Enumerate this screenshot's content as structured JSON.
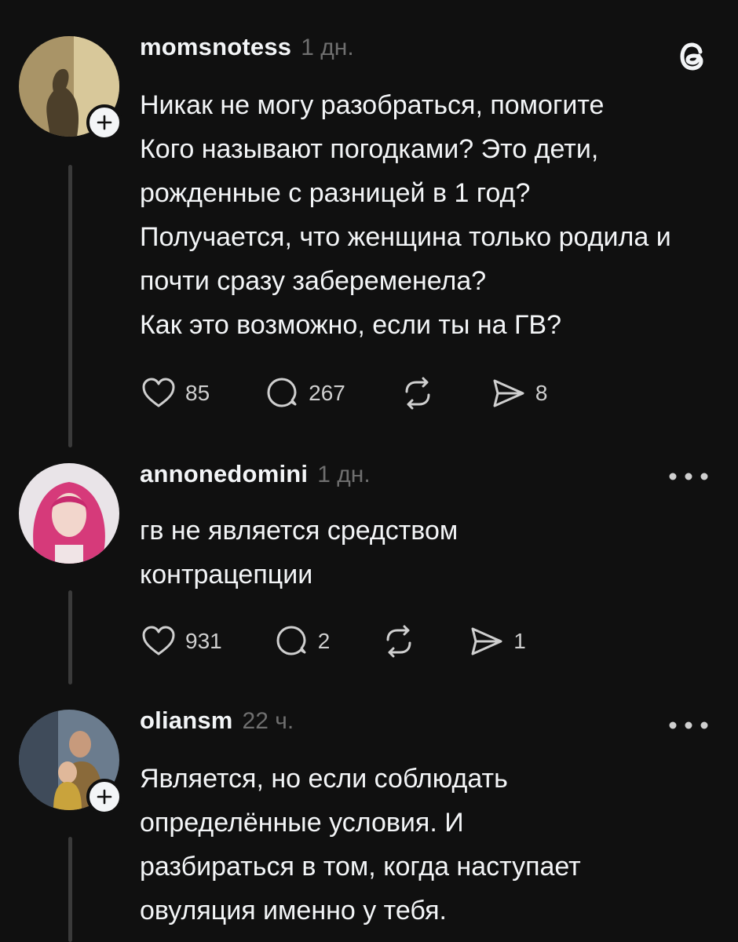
{
  "app": {
    "logo_icon": "threads-logo-icon"
  },
  "posts": [
    {
      "username": "momsnotess",
      "time": "1 дн.",
      "text": "Никак не могу разобраться, помогите\nКого называют погодками? Это дети, рожденные с разницей в 1 год?\nПолучается, что женщина только родила и почти сразу забеременела?\nКак это возможно, если ты на ГВ?",
      "likes": "85",
      "replies": "267",
      "reposts": "",
      "shares": "8",
      "has_follow_badge": true
    },
    {
      "username": "annonedomini",
      "time": "1 дн.",
      "text": "гв не является средством\nконтрацепции",
      "likes": "931",
      "replies": "2",
      "reposts": "",
      "shares": "1",
      "has_follow_badge": false
    },
    {
      "username": "oliansm",
      "time": "22 ч.",
      "text": "Является, но если соблюдать\nопределённые условия. И\nразбираться в том, когда наступает\nовуляция именно у тебя.",
      "has_follow_badge": true
    }
  ],
  "icons": {
    "like": "heart-icon",
    "reply": "comment-icon",
    "repost": "repost-icon",
    "share": "send-icon",
    "more": "more-horizontal-icon",
    "follow": "plus-icon"
  },
  "colors": {
    "background": "#101010",
    "text": "#f3f5f7",
    "muted": "#6f6f6f"
  }
}
